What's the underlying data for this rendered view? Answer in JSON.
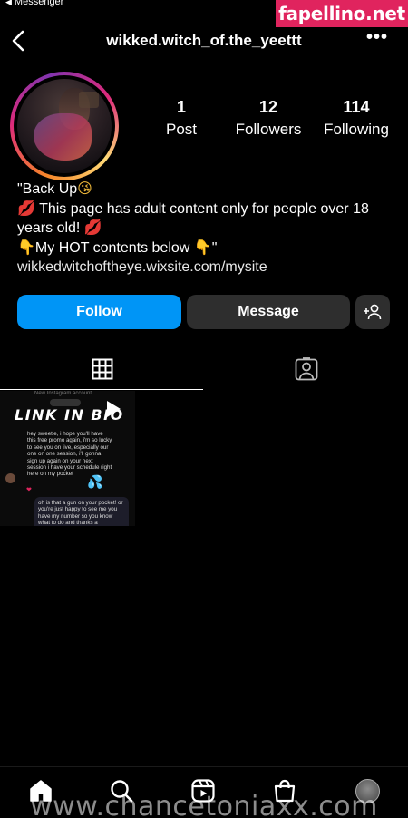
{
  "status_bar": {
    "back_app": "Messenger"
  },
  "watermark_top": "fapellino.net",
  "watermark_bottom": "www.chancetoniaxx.com",
  "header": {
    "username": "wikked.witch_of.the_yeettt",
    "more": "•••"
  },
  "stats": [
    {
      "count": "1",
      "label": "Post"
    },
    {
      "count": "12",
      "label": "Followers"
    },
    {
      "count": "114",
      "label": "Following"
    }
  ],
  "bio": {
    "line1": "\"Back Up",
    "line2": " This page has adult content only for people over 18 years old! ",
    "line3": "My HOT contents below ",
    "line3_end": "\"",
    "link": "wikkedwitchoftheye.wixsite.com/mysite"
  },
  "buttons": {
    "follow": "Follow",
    "message": "Message"
  },
  "post": {
    "faded_top": "New Instagram account",
    "headline": "LINK IN BIO",
    "message1": "hey sweetie, i hope you'll have this free promo again, i'm so lucky to see you on live, especially our one on one session, i'll gonna sign up again on your next session i have your schedule right here on my pocket",
    "message2": "oh is that a gun on your pocket! or you're just happy to see me you have my number so you know what to do and thanks a"
  },
  "colors": {
    "accent": "#0095f6",
    "secondary_button": "#2e2e2e",
    "watermark": "#e0245e"
  },
  "icons": {
    "header": [
      "chevron-left-icon",
      "more-options-icon"
    ],
    "tabs": [
      "grid-icon",
      "tagged-person-icon"
    ],
    "nav": [
      "home-icon",
      "search-icon",
      "reels-icon",
      "shop-icon",
      "profile-avatar"
    ]
  }
}
